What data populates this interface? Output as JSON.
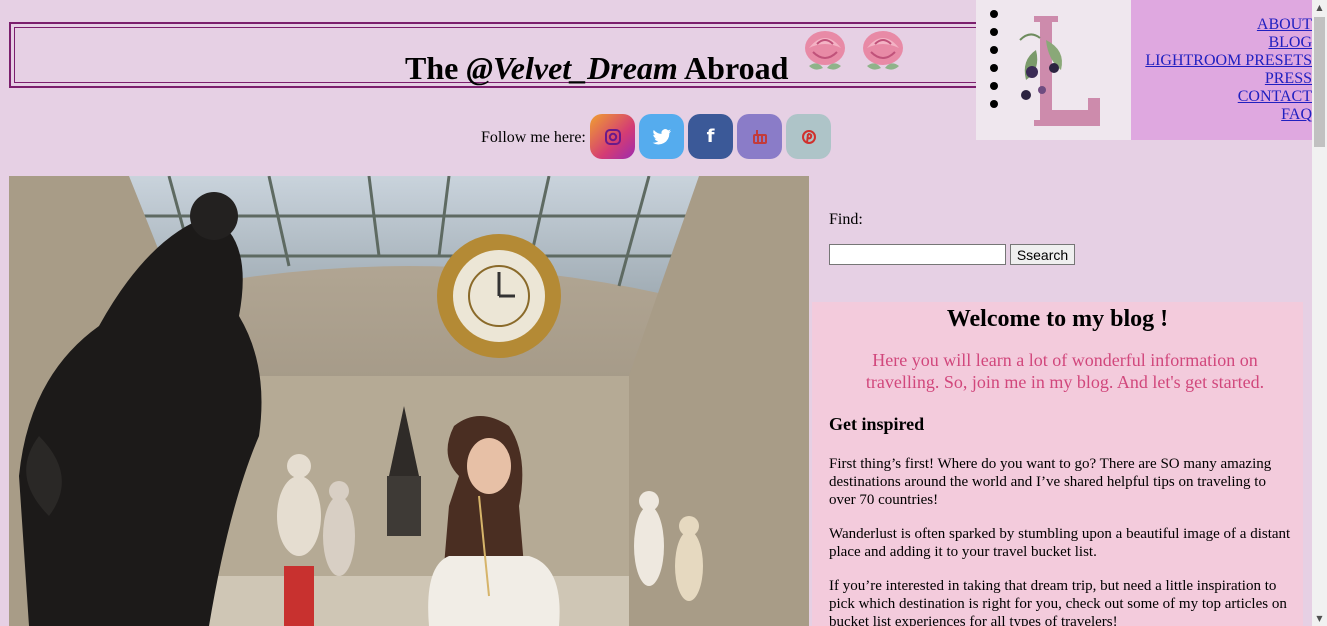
{
  "header": {
    "title_pre": "The ",
    "title_em": "@Velvet_Dream",
    "title_post": " Abroad",
    "follow_label": "Follow me here:"
  },
  "social": [
    {
      "name": "instagram",
      "glyph": "◎",
      "color": "#d43c74"
    },
    {
      "name": "twitter",
      "glyph": "🐦",
      "color": "#55acee"
    },
    {
      "name": "facebook",
      "glyph": "f",
      "color": "#3b5998"
    },
    {
      "name": "youtube",
      "glyph": "▣",
      "color": "#7a6bbd"
    },
    {
      "name": "pinterest",
      "glyph": "P",
      "color": "#a9bfc6"
    }
  ],
  "nav": {
    "links": [
      "ABOUT",
      "BLOG",
      "LIGHTROOM PRESETS",
      "PRESS",
      "CONTACT",
      "FAQ"
    ]
  },
  "search": {
    "label": "Find:",
    "button": "Ssearch",
    "value": ""
  },
  "welcome": {
    "heading": "Welcome to my blog !",
    "intro": "Here you will learn a lot of wonderful information on travelling. So, join me in my blog. And let's get started.",
    "subheading": "Get inspired",
    "p1": "First thing’s first! Where do you want to go? There are SO many amazing destinations around the world and I’ve shared helpful tips on traveling to over 70 countries!",
    "p2": "Wanderlust is often sparked by stumbling upon a beautiful image of a distant place and adding it to your travel bucket list.",
    "p3": "If you’re interested in taking that dream trip, but need a little inspiration to pick which destination is right for you, check out some of my top articles on bucket list experiences for all types of travelers!"
  },
  "colors": {
    "background": "#e6d0e4",
    "nav_bg": "#dfa8e0",
    "welcome_bg": "#f3cbdc",
    "intro_text": "#d1477c",
    "border": "#7b1f6d"
  }
}
